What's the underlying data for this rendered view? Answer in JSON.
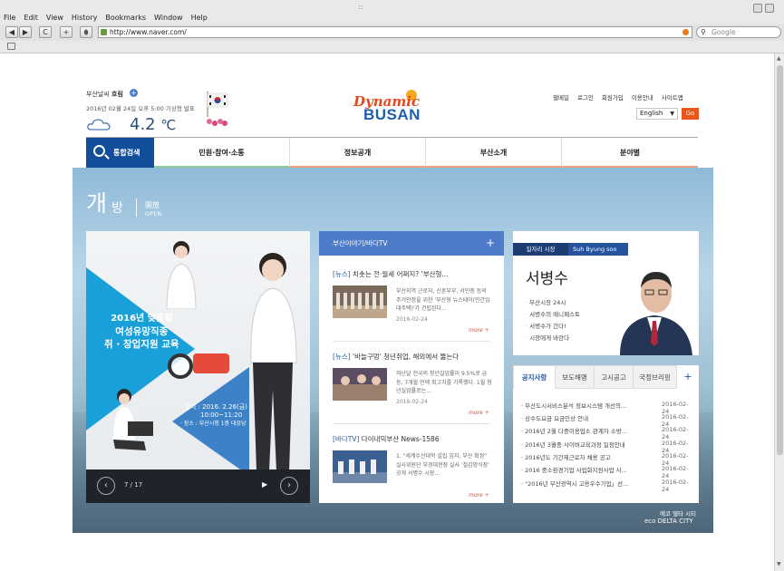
{
  "browser": {
    "menu": [
      "File",
      "Edit",
      "View",
      "History",
      "Bookmarks",
      "Window",
      "Help"
    ],
    "dots": "::",
    "back": "◀",
    "forward": "▶",
    "reload": "C",
    "new_tab": "+",
    "url": "http://www.naver.com/",
    "search_placeholder": "Google"
  },
  "weather": {
    "city_prefix": "부산날씨",
    "condition": "흐림",
    "plus": "+",
    "date": "2016년 02월 24일 오후 5:00 기상청 발표",
    "temp": "4.2",
    "unit": "℃"
  },
  "logo": {
    "top": "Dynamic",
    "bottom": "BUSAN"
  },
  "toplinks": [
    "웹메일",
    "로그인",
    "회원가입",
    "이용안내",
    "사이트맵"
  ],
  "lang": {
    "value": "English",
    "go": "Go"
  },
  "nav": {
    "search": "통합검색",
    "items": [
      "민원·참여·소통",
      "정보공개",
      "부산소개",
      "분야별"
    ]
  },
  "hero": {
    "title": "개",
    "title2": "방",
    "hanja": "開放",
    "en": "OPEN"
  },
  "banner": {
    "line1": "2016년 맞춤형",
    "line2": "여성유망직종",
    "line3": "취 · 창업지원 교육",
    "date": "· 일시 : 2016. 2.26(금)",
    "time": "10:00~11:20",
    "place": "· 장소 : 부산시청 1층 대강당",
    "count": "7 / 17",
    "prev": "‹",
    "next": "›",
    "play": "▶"
  },
  "news": {
    "header": "부산이야기/바다TV",
    "plus": "+",
    "items": [
      {
        "tag": "[뉴스]",
        "title": " 치솟는 전·월세 어쩌지? '부산형...",
        "desc": "부산지역 근로자, 신혼부부, 서민층 등의 주거안정을 위한 '부산형 뉴스테이(민간임대주택)'가 건립된다...",
        "date": "2016-02-24",
        "more": "more +"
      },
      {
        "tag": "[뉴스]",
        "title": " '바늘구멍' 청년취업, 해외에서 뚫는다",
        "desc": "저난달 전국의 청년실업률이 9.5%로 급등, 7개월 만에 최고치를 기록했다. 1월 청년실업률로는...",
        "date": "2016-02-24",
        "more": "more +"
      },
      {
        "tag": "[바다TV]",
        "title": " 다이내믹부산 News-1586",
        "desc": "1. \"세계수산대학 설립 입지, 부산 확정\" 실사위원단 부경대현장 실사 '철갑망식장' 공개 서병수 시장...",
        "date": "",
        "more": "more +"
      }
    ]
  },
  "mayor": {
    "tag": "일자리 시장",
    "en_name": "Suh Byung soo",
    "name": "서병수",
    "links": [
      "부산시장 24시",
      "서병수의 매니페스토",
      "서병수가 간다!",
      "시장에게 바란다"
    ]
  },
  "notice": {
    "tabs": [
      "공지사항",
      "보도해명",
      "고시공고",
      "국정브리핑"
    ],
    "plus": "+",
    "items": [
      {
        "title": "· 부산도시서비스분석 정보시스템 개선의...",
        "date": "2016-02-24"
      },
      {
        "title": "· 상수도요금 요금인상 안내",
        "date": "2016-02-24"
      },
      {
        "title": "· 2016년 2월 다중이용업소 관계자 소방...",
        "date": "2016-02-24"
      },
      {
        "title": "· 2016년 3월중 사이버교육과정 일정안내",
        "date": "2016-02-24"
      },
      {
        "title": "· 2016년도 기간제근로자 채용 공고",
        "date": "2016-02-24"
      },
      {
        "title": "· 2016 중소환경기업 사업화지원사업 사...",
        "date": "2016-02-24"
      },
      {
        "title": "· \"2016년 부산광역시 고용우수기업」선...",
        "date": "2016-02-24"
      }
    ]
  },
  "eco": {
    "ko": "에코 델타 시티",
    "en": "eco DELTA CITY"
  }
}
